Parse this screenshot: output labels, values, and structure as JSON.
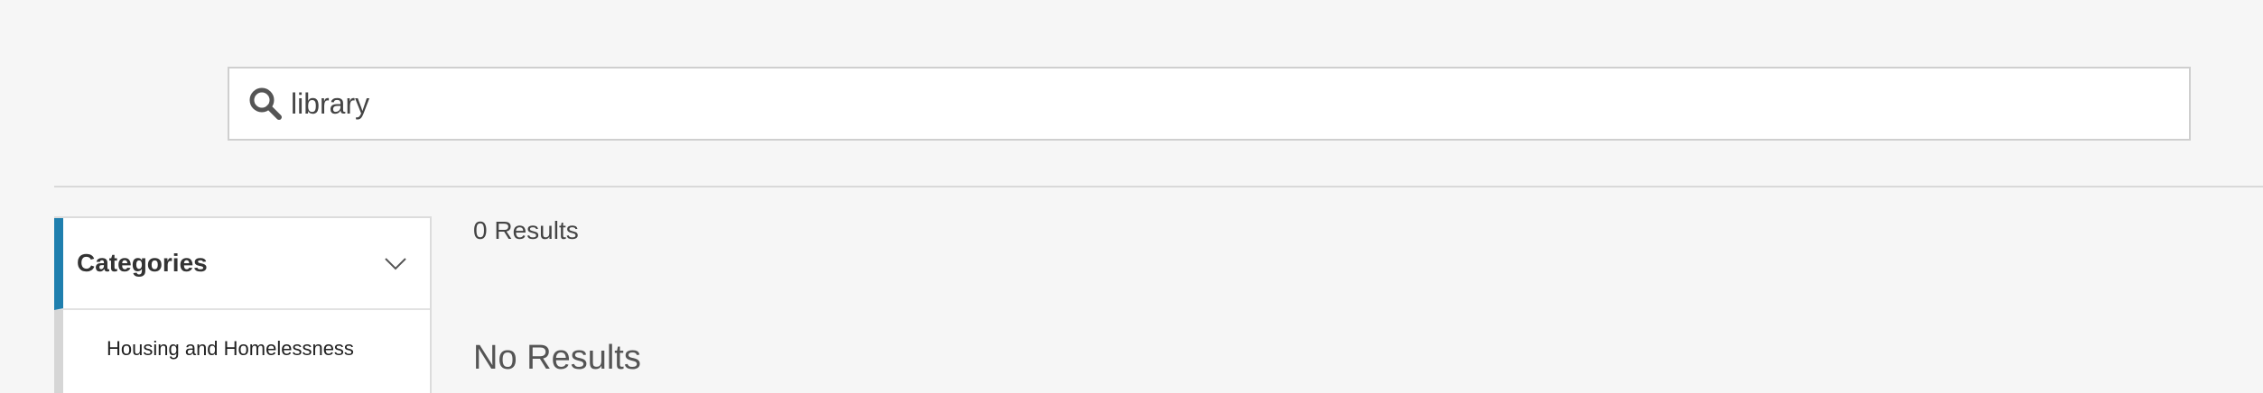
{
  "search": {
    "value": "library",
    "icon": "search-icon"
  },
  "sidebar": {
    "title": "Categories",
    "toggle_icon": "chevron-down-icon",
    "items": [
      {
        "label": "Housing and Homelessness"
      }
    ]
  },
  "results": {
    "count_label": "0 Results",
    "empty_label": "No Results"
  },
  "colors": {
    "accent": "#1f7fae",
    "background": "#f6f6f6"
  }
}
